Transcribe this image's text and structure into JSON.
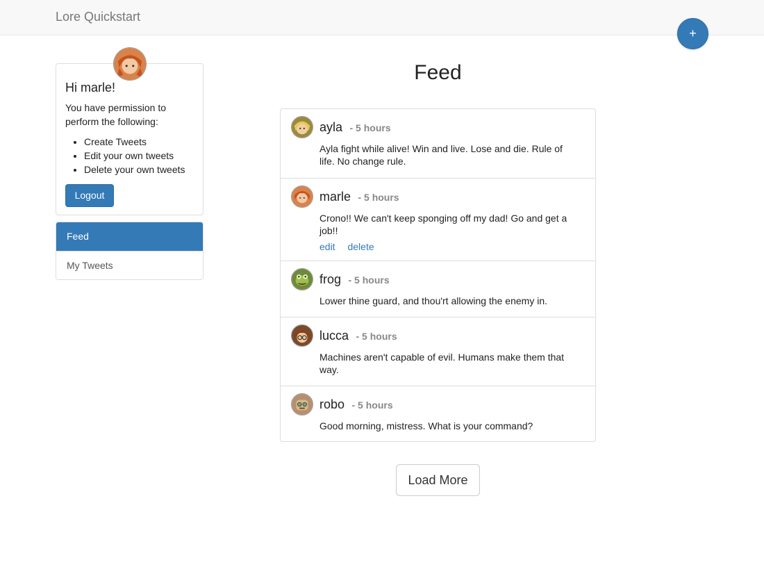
{
  "app": {
    "brand": "Lore Quickstart",
    "add_button": "+"
  },
  "profile": {
    "greeting": "Hi marle!",
    "permission_text": "You have permission to perform the following:",
    "permissions": [
      "Create Tweets",
      "Edit your own tweets",
      "Delete your own tweets"
    ],
    "logout_label": "Logout",
    "avatar": "marle-avatar"
  },
  "nav": {
    "items": [
      {
        "label": "Feed",
        "active": true
      },
      {
        "label": "My Tweets",
        "active": false
      }
    ]
  },
  "feed": {
    "title": "Feed",
    "tweets": [
      {
        "user": "ayla",
        "time": "- 5 hours",
        "text": "Ayla fight while alive! Win and live. Lose and die. Rule of life. No change rule."
      },
      {
        "user": "marle",
        "time": "- 5 hours",
        "text": "Crono!! We can't keep sponging off my dad! Go and get a job!!",
        "actions": {
          "edit": "edit",
          "delete": "delete"
        }
      },
      {
        "user": "frog",
        "time": "- 5 hours",
        "text": "Lower thine guard, and thou'rt allowing the enemy in."
      },
      {
        "user": "lucca",
        "time": "- 5 hours",
        "text": "Machines aren't capable of evil. Humans make them that way."
      },
      {
        "user": "robo",
        "time": "- 5 hours",
        "text": "Good morning, mistress. What is your command?"
      }
    ],
    "load_more_label": "Load More"
  },
  "colors": {
    "primary": "#337ab7",
    "navbar": "#f8f8f8",
    "muted": "#888888"
  }
}
